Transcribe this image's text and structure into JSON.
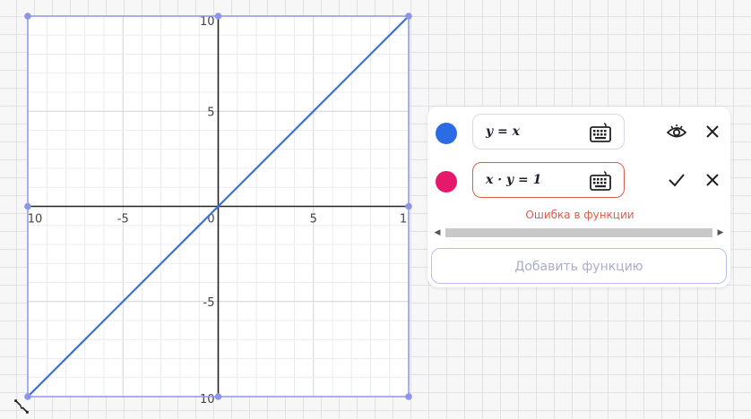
{
  "graph": {
    "x_range": [
      -10,
      10
    ],
    "y_range": [
      -10,
      10
    ],
    "major_step": 5,
    "x_tick_labels": [
      "10",
      "-5",
      "0",
      "5",
      "1"
    ],
    "y_tick_labels": [
      "10",
      "5",
      "-5",
      "10"
    ],
    "line_color": "#3a6fd8",
    "frame_color": "#8d96e6"
  },
  "functions": [
    {
      "expression": "y = x",
      "color": "#2b6be4",
      "status": "ok"
    },
    {
      "expression": "x · y = 1",
      "color": "#e5186b",
      "status": "error"
    }
  ],
  "error_message": "Ошибка в функции",
  "add_button_label": "Добавить функцию",
  "icons": {
    "keyboard": "keyboard-icon",
    "visibility": "eye-icon",
    "delete": "close-icon",
    "confirm": "check-icon",
    "resize": "resize-icon"
  }
}
